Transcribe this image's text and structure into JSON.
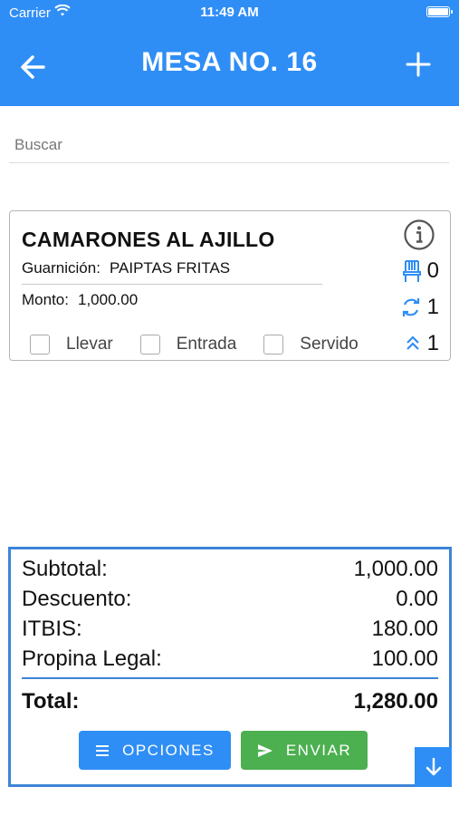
{
  "status_bar": {
    "carrier": "Carrier",
    "time": "11:49 AM"
  },
  "header": {
    "title": "MESA NO. 16"
  },
  "search": {
    "placeholder": "Buscar",
    "value": ""
  },
  "item": {
    "name": "CAMARONES AL AJILLO",
    "garnish_label": "Guarnición:",
    "garnish_value": "PAIPTAS FRITAS",
    "amount_label": "Monto:",
    "amount_value": "1,000.00",
    "counters": {
      "chair": "0",
      "sync": "1",
      "priority": "1"
    },
    "checkboxes": [
      {
        "label": "Llevar",
        "checked": false
      },
      {
        "label": "Entrada",
        "checked": false
      },
      {
        "label": "Servido",
        "checked": false
      }
    ]
  },
  "summary": {
    "subtotal_label": "Subtotal:",
    "subtotal_value": "1,000.00",
    "discount_label": "Descuento:",
    "discount_value": "0.00",
    "itbis_label": "ITBIS:",
    "itbis_value": "180.00",
    "tip_label": "Propina Legal:",
    "tip_value": "100.00",
    "total_label": "Total:",
    "total_value": "1,280.00"
  },
  "buttons": {
    "options": "OPCIONES",
    "send": "ENVIAR"
  },
  "colors": {
    "primary": "#2f8ef5",
    "success": "#4caf50",
    "panel_border": "#3d84d6"
  },
  "icons": [
    "wifi-icon",
    "battery-icon",
    "back-arrow-icon",
    "plus-icon",
    "info-icon",
    "chair-icon",
    "sync-icon",
    "chevrons-up-icon",
    "menu-icon",
    "send-icon",
    "arrow-down-icon"
  ]
}
